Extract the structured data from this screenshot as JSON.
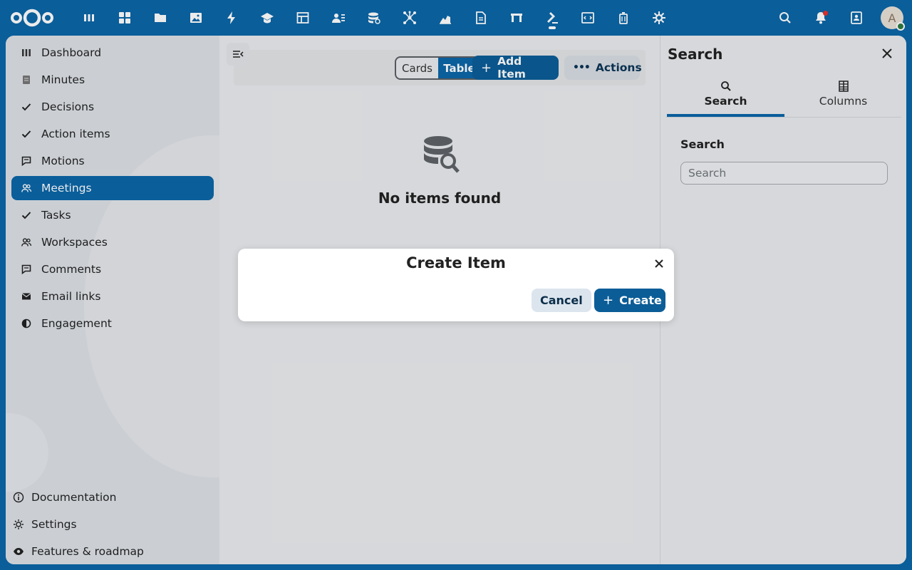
{
  "topbar": {
    "logo_icon": "nextcloud-logo-icon",
    "apps": [
      {
        "icon": "dashboard-icon"
      },
      {
        "icon": "grid-apps-icon"
      },
      {
        "icon": "folder-icon"
      },
      {
        "icon": "photos-icon"
      },
      {
        "icon": "activity-bolt-icon"
      },
      {
        "icon": "learning-cap-icon"
      },
      {
        "icon": "tables-icon"
      },
      {
        "icon": "contacts-icon"
      },
      {
        "icon": "database-settings-icon"
      },
      {
        "icon": "network-icon"
      },
      {
        "icon": "analytics-icon"
      },
      {
        "icon": "document-icon"
      },
      {
        "icon": "deck-board-icon"
      },
      {
        "icon": "gavel-icon",
        "active": true
      },
      {
        "icon": "code-window-icon"
      },
      {
        "icon": "trash-icon"
      },
      {
        "icon": "settings-cog-icon"
      }
    ],
    "right": [
      "search-icon",
      "bell-icon",
      "contacts-card-icon"
    ],
    "avatar_initial": "A"
  },
  "sidebar": {
    "items": [
      {
        "label": "Dashboard",
        "icon": "dashboard-bars-icon"
      },
      {
        "label": "Minutes",
        "icon": "minutes-note-icon"
      },
      {
        "label": "Decisions",
        "icon": "check-icon"
      },
      {
        "label": "Action items",
        "icon": "check-icon"
      },
      {
        "label": "Motions",
        "icon": "comment-icon"
      },
      {
        "label": "Meetings",
        "icon": "people-icon",
        "active": true
      },
      {
        "label": "Tasks",
        "icon": "check-icon"
      },
      {
        "label": "Workspaces",
        "icon": "people-icon"
      },
      {
        "label": "Comments",
        "icon": "comment-icon"
      },
      {
        "label": "Email links",
        "icon": "email-icon"
      },
      {
        "label": "Engagement",
        "icon": "half-circle-icon"
      }
    ],
    "bottom": [
      {
        "label": "Documentation",
        "icon": "info-icon"
      },
      {
        "label": "Settings",
        "icon": "gear-icon"
      },
      {
        "label": "Features & roadmap",
        "icon": "eye-icon"
      }
    ]
  },
  "toolbar": {
    "view_cards": "Cards",
    "view_table": "Table",
    "add_item": "Add Item",
    "actions": "Actions"
  },
  "main": {
    "empty_text": "No items found"
  },
  "right_panel": {
    "title": "Search",
    "tabs": [
      {
        "label": "Search",
        "active": true
      },
      {
        "label": "Columns"
      }
    ],
    "search_label": "Search",
    "search_placeholder": "Search"
  },
  "modal": {
    "title": "Create Item",
    "cancel": "Cancel",
    "create": "Create"
  },
  "colors": {
    "brand": "#0b66a8",
    "primary_button": "#0b5d97",
    "notification": "#e9322d",
    "status_online": "#2d7b41"
  }
}
